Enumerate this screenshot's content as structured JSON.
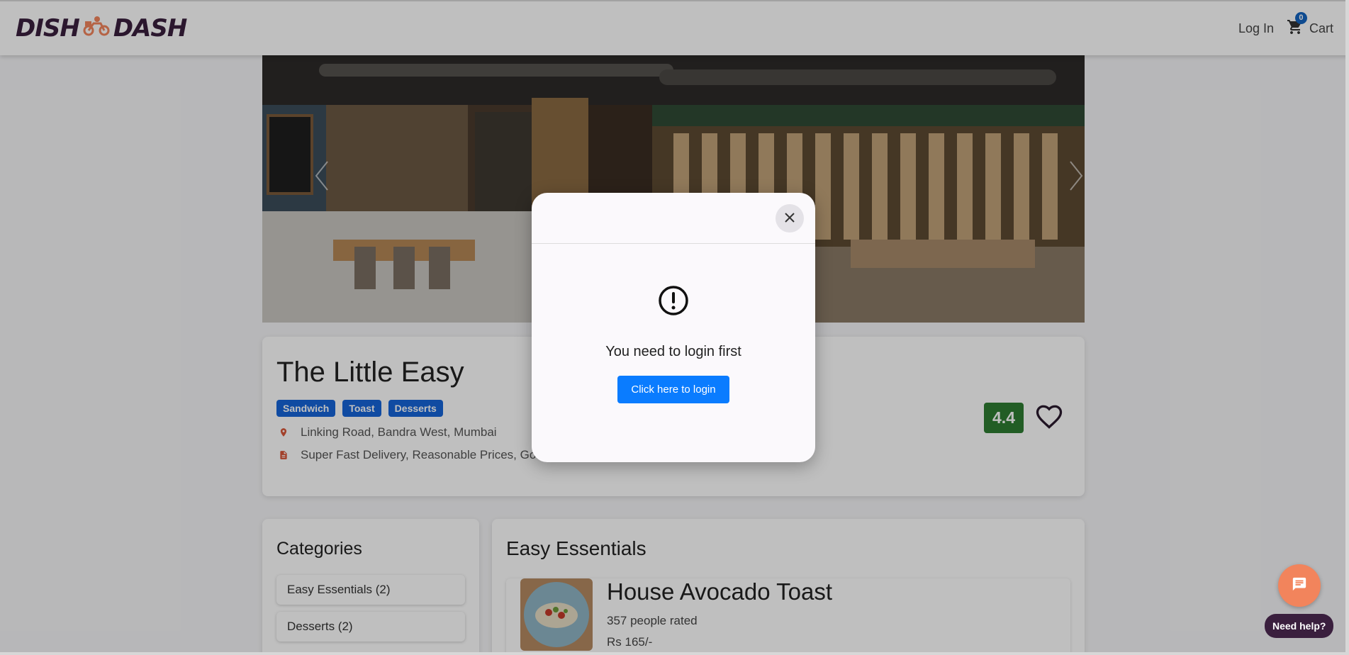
{
  "header": {
    "logo_left": "DISH",
    "logo_right": "DASH",
    "login_label": "Log In",
    "cart_label": "Cart",
    "cart_count": "0"
  },
  "restaurant": {
    "name": "The Little Easy",
    "tags": [
      "Sandwich",
      "Toast",
      "Desserts"
    ],
    "address": "Linking Road, Bandra West, Mumbai",
    "highlights": "Super Fast Delivery, Reasonable Prices, Good Delivery, Value for Money, Good Taste, Packing",
    "rating": "4.4"
  },
  "categories": {
    "title": "Categories",
    "items": [
      "Easy Essentials (2)",
      "Desserts (2)"
    ]
  },
  "menu": {
    "section_title": "Easy Essentials",
    "dish": {
      "name": "House Avocado Toast",
      "ratings": "357 people rated",
      "price": "Rs 165/-"
    }
  },
  "modal": {
    "message": "You need to login first",
    "button_label": "Click here to login"
  },
  "chat": {
    "help_label": "Need help?"
  },
  "colors": {
    "brand": "#3a1f3e",
    "accent": "#f2845c",
    "tag": "#1665d8",
    "rating": "#2e7d32",
    "primary_button": "#0a7cff"
  }
}
